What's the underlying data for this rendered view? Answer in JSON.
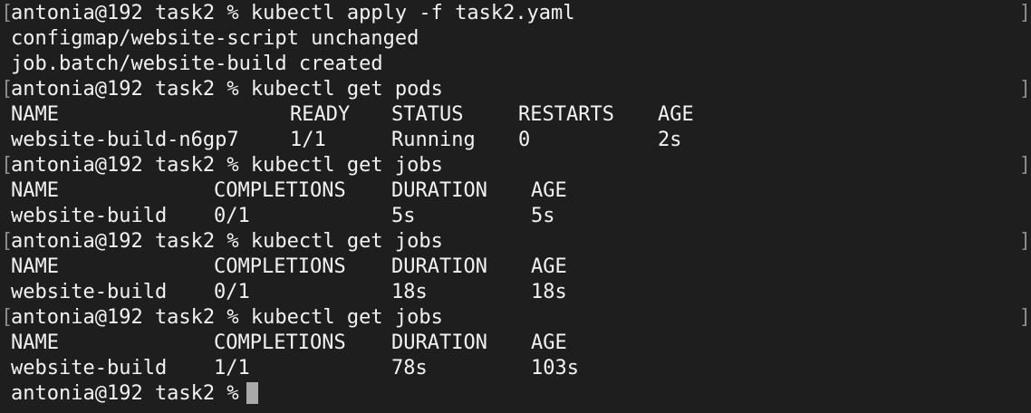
{
  "terminal": {
    "prompt": "antonia@192 task2 %",
    "lines": [
      {
        "type": "prompt",
        "command": "kubectl apply -f task2.yaml"
      },
      {
        "type": "output",
        "text": "configmap/website-script unchanged"
      },
      {
        "type": "output",
        "text": "job.batch/website-build created"
      },
      {
        "type": "prompt",
        "command": "kubectl get pods"
      },
      {
        "type": "pods-header",
        "cols": [
          "NAME",
          "READY",
          "STATUS",
          "RESTARTS",
          "AGE"
        ]
      },
      {
        "type": "pods-row",
        "cols": [
          "website-build-n6gp7",
          "1/1",
          "Running",
          "0",
          "2s"
        ]
      },
      {
        "type": "prompt",
        "command": "kubectl get jobs"
      },
      {
        "type": "jobs-header",
        "cols": [
          "NAME",
          "COMPLETIONS",
          "DURATION",
          "AGE"
        ]
      },
      {
        "type": "jobs-row",
        "cols": [
          "website-build",
          "0/1",
          "5s",
          "5s"
        ]
      },
      {
        "type": "prompt",
        "command": "kubectl get jobs"
      },
      {
        "type": "jobs-header",
        "cols": [
          "NAME",
          "COMPLETIONS",
          "DURATION",
          "AGE"
        ]
      },
      {
        "type": "jobs-row",
        "cols": [
          "website-build",
          "0/1",
          "18s",
          "18s"
        ]
      },
      {
        "type": "prompt",
        "command": "kubectl get jobs"
      },
      {
        "type": "jobs-header",
        "cols": [
          "NAME",
          "COMPLETIONS",
          "DURATION",
          "AGE"
        ]
      },
      {
        "type": "jobs-row",
        "cols": [
          "website-build",
          "1/1",
          "78s",
          "103s"
        ]
      },
      {
        "type": "current-prompt"
      }
    ]
  },
  "colors": {
    "background": "#1e1e1e",
    "text": "#f2f2f2",
    "cursor": "#a9a9a9"
  }
}
